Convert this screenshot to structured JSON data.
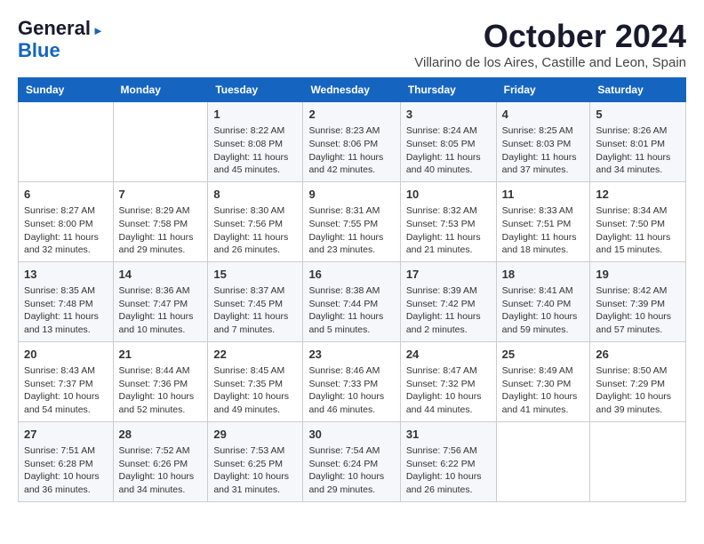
{
  "logo": {
    "line1": "General",
    "line2": "Blue"
  },
  "title": "October 2024",
  "subtitle": "Villarino de los Aires, Castille and Leon, Spain",
  "headers": [
    "Sunday",
    "Monday",
    "Tuesday",
    "Wednesday",
    "Thursday",
    "Friday",
    "Saturday"
  ],
  "weeks": [
    [
      {
        "day": "",
        "info": ""
      },
      {
        "day": "",
        "info": ""
      },
      {
        "day": "1",
        "info": "Sunrise: 8:22 AM\nSunset: 8:08 PM\nDaylight: 11 hours and 45 minutes."
      },
      {
        "day": "2",
        "info": "Sunrise: 8:23 AM\nSunset: 8:06 PM\nDaylight: 11 hours and 42 minutes."
      },
      {
        "day": "3",
        "info": "Sunrise: 8:24 AM\nSunset: 8:05 PM\nDaylight: 11 hours and 40 minutes."
      },
      {
        "day": "4",
        "info": "Sunrise: 8:25 AM\nSunset: 8:03 PM\nDaylight: 11 hours and 37 minutes."
      },
      {
        "day": "5",
        "info": "Sunrise: 8:26 AM\nSunset: 8:01 PM\nDaylight: 11 hours and 34 minutes."
      }
    ],
    [
      {
        "day": "6",
        "info": "Sunrise: 8:27 AM\nSunset: 8:00 PM\nDaylight: 11 hours and 32 minutes."
      },
      {
        "day": "7",
        "info": "Sunrise: 8:29 AM\nSunset: 7:58 PM\nDaylight: 11 hours and 29 minutes."
      },
      {
        "day": "8",
        "info": "Sunrise: 8:30 AM\nSunset: 7:56 PM\nDaylight: 11 hours and 26 minutes."
      },
      {
        "day": "9",
        "info": "Sunrise: 8:31 AM\nSunset: 7:55 PM\nDaylight: 11 hours and 23 minutes."
      },
      {
        "day": "10",
        "info": "Sunrise: 8:32 AM\nSunset: 7:53 PM\nDaylight: 11 hours and 21 minutes."
      },
      {
        "day": "11",
        "info": "Sunrise: 8:33 AM\nSunset: 7:51 PM\nDaylight: 11 hours and 18 minutes."
      },
      {
        "day": "12",
        "info": "Sunrise: 8:34 AM\nSunset: 7:50 PM\nDaylight: 11 hours and 15 minutes."
      }
    ],
    [
      {
        "day": "13",
        "info": "Sunrise: 8:35 AM\nSunset: 7:48 PM\nDaylight: 11 hours and 13 minutes."
      },
      {
        "day": "14",
        "info": "Sunrise: 8:36 AM\nSunset: 7:47 PM\nDaylight: 11 hours and 10 minutes."
      },
      {
        "day": "15",
        "info": "Sunrise: 8:37 AM\nSunset: 7:45 PM\nDaylight: 11 hours and 7 minutes."
      },
      {
        "day": "16",
        "info": "Sunrise: 8:38 AM\nSunset: 7:44 PM\nDaylight: 11 hours and 5 minutes."
      },
      {
        "day": "17",
        "info": "Sunrise: 8:39 AM\nSunset: 7:42 PM\nDaylight: 11 hours and 2 minutes."
      },
      {
        "day": "18",
        "info": "Sunrise: 8:41 AM\nSunset: 7:40 PM\nDaylight: 10 hours and 59 minutes."
      },
      {
        "day": "19",
        "info": "Sunrise: 8:42 AM\nSunset: 7:39 PM\nDaylight: 10 hours and 57 minutes."
      }
    ],
    [
      {
        "day": "20",
        "info": "Sunrise: 8:43 AM\nSunset: 7:37 PM\nDaylight: 10 hours and 54 minutes."
      },
      {
        "day": "21",
        "info": "Sunrise: 8:44 AM\nSunset: 7:36 PM\nDaylight: 10 hours and 52 minutes."
      },
      {
        "day": "22",
        "info": "Sunrise: 8:45 AM\nSunset: 7:35 PM\nDaylight: 10 hours and 49 minutes."
      },
      {
        "day": "23",
        "info": "Sunrise: 8:46 AM\nSunset: 7:33 PM\nDaylight: 10 hours and 46 minutes."
      },
      {
        "day": "24",
        "info": "Sunrise: 8:47 AM\nSunset: 7:32 PM\nDaylight: 10 hours and 44 minutes."
      },
      {
        "day": "25",
        "info": "Sunrise: 8:49 AM\nSunset: 7:30 PM\nDaylight: 10 hours and 41 minutes."
      },
      {
        "day": "26",
        "info": "Sunrise: 8:50 AM\nSunset: 7:29 PM\nDaylight: 10 hours and 39 minutes."
      }
    ],
    [
      {
        "day": "27",
        "info": "Sunrise: 7:51 AM\nSunset: 6:28 PM\nDaylight: 10 hours and 36 minutes."
      },
      {
        "day": "28",
        "info": "Sunrise: 7:52 AM\nSunset: 6:26 PM\nDaylight: 10 hours and 34 minutes."
      },
      {
        "day": "29",
        "info": "Sunrise: 7:53 AM\nSunset: 6:25 PM\nDaylight: 10 hours and 31 minutes."
      },
      {
        "day": "30",
        "info": "Sunrise: 7:54 AM\nSunset: 6:24 PM\nDaylight: 10 hours and 29 minutes."
      },
      {
        "day": "31",
        "info": "Sunrise: 7:56 AM\nSunset: 6:22 PM\nDaylight: 10 hours and 26 minutes."
      },
      {
        "day": "",
        "info": ""
      },
      {
        "day": "",
        "info": ""
      }
    ]
  ]
}
